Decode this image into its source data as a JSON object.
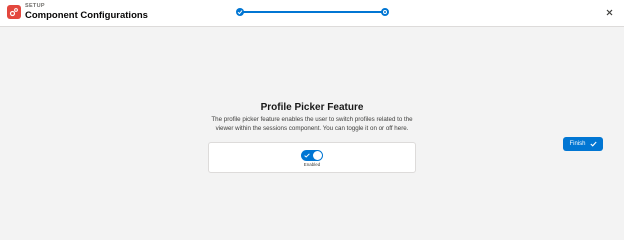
{
  "header": {
    "eyebrow": "SETUP",
    "title": "Component Configurations",
    "app_icon": "setup-gear-icon",
    "close_icon": "close-icon"
  },
  "progress": {
    "steps": [
      {
        "state": "complete"
      },
      {
        "state": "current"
      }
    ],
    "value": 1.0
  },
  "feature": {
    "title": "Profile Picker Feature",
    "description": "The profile picker feature enables the user to switch profiles related to the viewer within the sessions component. You can toggle it on or off here.",
    "toggle_on": true,
    "toggle_label": "Enabled"
  },
  "actions": {
    "finish_label": "Finish",
    "finish_icon": "check-icon"
  },
  "colors": {
    "brand": "#0176d3",
    "app_icon_bg": "#e3473e",
    "page_bg": "#f3f3f3"
  }
}
